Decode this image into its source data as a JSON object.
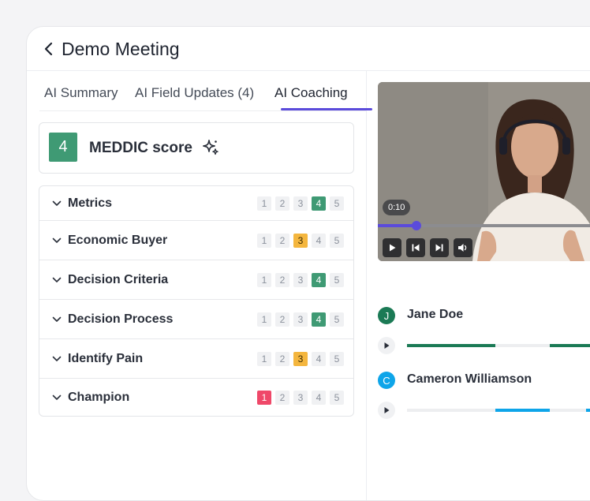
{
  "header": {
    "title": "Demo Meeting",
    "back_icon": "chevron-left-icon"
  },
  "tabs": [
    {
      "label": "AI Summary",
      "active": false
    },
    {
      "label": "AI Field Updates (4)",
      "active": false
    },
    {
      "label": "AI Coaching",
      "active": true
    }
  ],
  "colors": {
    "accent": "#5b4bdb",
    "green": "#3f9a74",
    "yellow": "#f4b63e",
    "red": "#ef4869",
    "speaker_green": "#1b7a55",
    "speaker_blue": "#0ea5e9"
  },
  "score": {
    "value": "4",
    "title": "MEDDIC score",
    "icon": "sparkle-icon"
  },
  "criteria": [
    {
      "label": "Metrics",
      "scale": [
        "1",
        "2",
        "3",
        "4",
        "5"
      ],
      "selected": 4
    },
    {
      "label": "Economic Buyer",
      "scale": [
        "1",
        "2",
        "3",
        "4",
        "5"
      ],
      "selected": 3
    },
    {
      "label": "Decision Criteria",
      "scale": [
        "1",
        "2",
        "3",
        "4",
        "5"
      ],
      "selected": 4
    },
    {
      "label": "Decision Process",
      "scale": [
        "1",
        "2",
        "3",
        "4",
        "5"
      ],
      "selected": 4
    },
    {
      "label": "Identify Pain",
      "scale": [
        "1",
        "2",
        "3",
        "4",
        "5"
      ],
      "selected": 3
    },
    {
      "label": "Champion",
      "scale": [
        "1",
        "2",
        "3",
        "4",
        "5"
      ],
      "selected": 1
    }
  ],
  "video": {
    "time": "0:10",
    "progress": 0.17
  },
  "speakers": [
    {
      "initial": "J",
      "name": "Jane Doe",
      "color": "#1b7a55"
    },
    {
      "initial": "C",
      "name": "Cameron Williamson",
      "color": "#0ea5e9"
    }
  ]
}
